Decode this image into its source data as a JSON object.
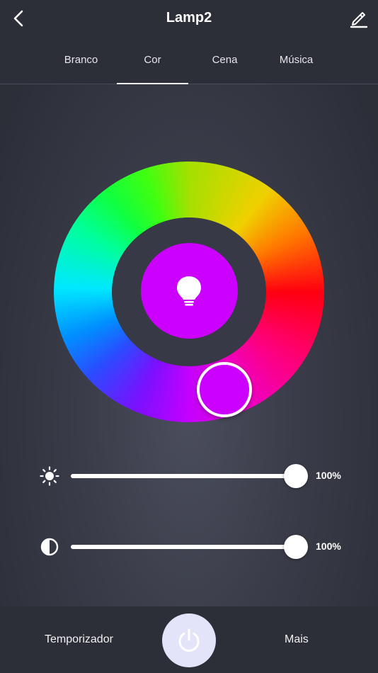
{
  "header": {
    "title": "Lamp2",
    "back_icon": "chevron-left-icon",
    "edit_icon": "pencil-icon"
  },
  "tabs": [
    {
      "label": "Branco",
      "active": false
    },
    {
      "label": "Cor",
      "active": true
    },
    {
      "label": "Cena",
      "active": false
    },
    {
      "label": "Música",
      "active": false
    }
  ],
  "color_picker": {
    "selected_color": "#cc00ff",
    "center_icon": "lightbulb-icon"
  },
  "sliders": {
    "brightness": {
      "icon": "sun-icon",
      "value_label": "100%",
      "value": 1.0
    },
    "contrast": {
      "icon": "contrast-icon",
      "value_label": "100%",
      "value": 1.0
    }
  },
  "footer": {
    "timer_label": "Temporizador",
    "more_label": "Mais",
    "power_icon": "power-icon"
  },
  "colors": {
    "background": "#2c2e38",
    "accent_power": "#e3e3fa",
    "text": "#ffffff"
  }
}
